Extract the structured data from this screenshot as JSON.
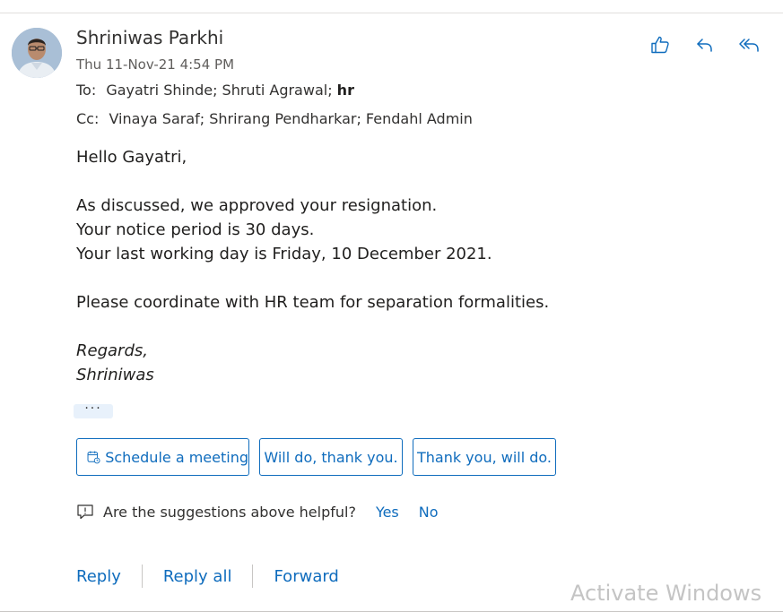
{
  "message": {
    "sender": "Shriniwas Parkhi",
    "date": "Thu 11-Nov-21 4:54 PM",
    "to_label": "To:",
    "to_recipients": "Gayatri Shinde; Shruti Agrawal;",
    "to_bold": "hr",
    "cc_label": "Cc:",
    "cc_recipients": "Vinaya Saraf; Shrirang Pendharkar; Fendahl Admin"
  },
  "header_actions": {
    "like": "like-icon",
    "reply": "reply-icon",
    "reply_all": "reply-all-icon"
  },
  "body": {
    "greeting": "Hello Gayatri,",
    "line1": "As discussed, we approved your resignation.",
    "line2": "Your notice period is 30 days.",
    "line3": "Your last working day is Friday, 10 December 2021.",
    "line4": "Please coordinate with HR team for separation formalities.",
    "regards": "Regards,",
    "signature": "Shriniwas"
  },
  "more_label": "···",
  "suggestions": {
    "schedule": "Schedule a meeting",
    "will_do": "Will do, thank you.",
    "thank_you": "Thank you, will do."
  },
  "feedback": {
    "question": "Are the suggestions above helpful?",
    "yes": "Yes",
    "no": "No"
  },
  "reply_bar": {
    "reply": "Reply",
    "reply_all": "Reply all",
    "forward": "Forward"
  },
  "watermark": "Activate Windows",
  "colors": {
    "accent": "#0f6cbd",
    "text": "#201f1e",
    "muted": "#605e5c"
  }
}
